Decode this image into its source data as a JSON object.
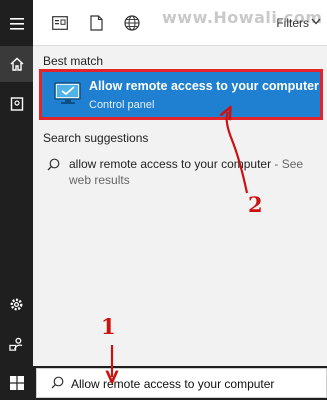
{
  "watermark": "www.Howali.com",
  "topbar": {
    "filters_label": "Filters"
  },
  "best_match": {
    "section_label": "Best match",
    "title": "Allow remote access to your computer",
    "subtitle": "Control panel"
  },
  "suggestions": {
    "section_label": "Search suggestions",
    "items": [
      {
        "term": "allow remote access to your computer",
        "suffix": " - See web results"
      }
    ]
  },
  "searchbox": {
    "value": "Allow remote access to your computer"
  },
  "annotations": {
    "step1": "1",
    "step2": "2"
  },
  "colors": {
    "highlight": "#1f7fd0",
    "callout_red": "#cc1111",
    "rail": "#1f1f1f"
  }
}
